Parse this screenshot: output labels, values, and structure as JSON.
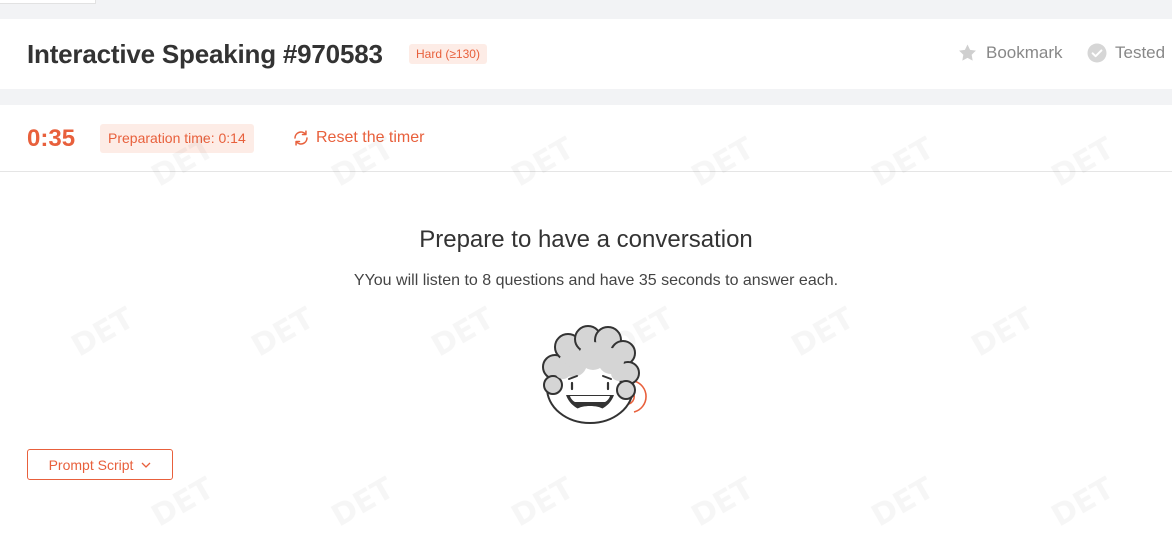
{
  "header": {
    "title": "Interactive Speaking #970583",
    "difficulty": "Hard (≥130)",
    "bookmark_label": "Bookmark",
    "tested_label": "Tested"
  },
  "timer": {
    "time": "0:35",
    "preparation": "Preparation time: 0:14",
    "reset_label": "Reset the timer"
  },
  "main": {
    "heading": "Prepare to have a conversation",
    "subtext": "YYou will listen to 8 questions and have 35 seconds to answer each."
  },
  "footer": {
    "prompt_script_label": "Prompt Script"
  },
  "watermark": {
    "text": "DET"
  },
  "icons": {
    "bookmark": "star-icon",
    "tested": "check-circle-icon",
    "reset": "refresh-icon",
    "prompt_dropdown": "chevron-down-icon",
    "avatar": "curly-hair-speaker-avatar"
  },
  "colors": {
    "accent": "#e8603c",
    "accent_bg": "#fdece6",
    "muted": "#888888",
    "strip_bg": "#f2f3f5"
  }
}
